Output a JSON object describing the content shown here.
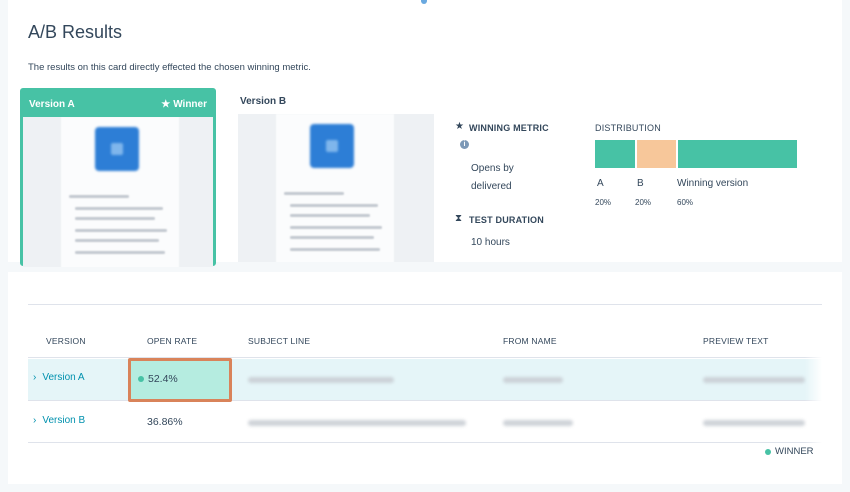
{
  "page": {
    "title": "A/B Results",
    "subtitle": "The results on this card directly effected the chosen winning metric."
  },
  "versions": {
    "a": {
      "label": "Version A",
      "winner_label": "Winner"
    },
    "b": {
      "label": "Version B"
    }
  },
  "metric": {
    "winning_label": "WINNING METRIC",
    "winning_value_line1": "Opens by",
    "winning_value_line2": "delivered",
    "duration_label": "TEST DURATION",
    "duration_value": "10 hours"
  },
  "distribution": {
    "label": "DISTRIBUTION",
    "segments": [
      {
        "name": "A",
        "percent": "20%",
        "fraction": 0.2,
        "color": "#47c2a5"
      },
      {
        "name": "B",
        "percent": "20%",
        "fraction": 0.2,
        "color": "#f7c79a"
      },
      {
        "name": "Winning version",
        "percent": "60%",
        "fraction": 0.6,
        "color": "#47c2a5"
      }
    ]
  },
  "table": {
    "headers": [
      "VERSION",
      "OPEN RATE",
      "SUBJECT LINE",
      "FROM NAME",
      "PREVIEW TEXT"
    ],
    "rows": [
      {
        "version": "Version A",
        "open_rate": "52.4%"
      },
      {
        "version": "Version B",
        "open_rate": "36.86%"
      }
    ],
    "legend": "WINNER"
  },
  "icons": {
    "winner": "star-icon",
    "winning_metric": "star-icon",
    "info": "info-icon",
    "duration": "hourglass-icon",
    "row_expand": "chevron-right-icon",
    "winner_dot": "dot-icon"
  },
  "colors": {
    "accent": "#47c2a5",
    "link": "#0091ae",
    "distribution_b": "#f7c79a",
    "highlight_border": "#d9835a",
    "highlight_fill": "#b5ece0"
  }
}
